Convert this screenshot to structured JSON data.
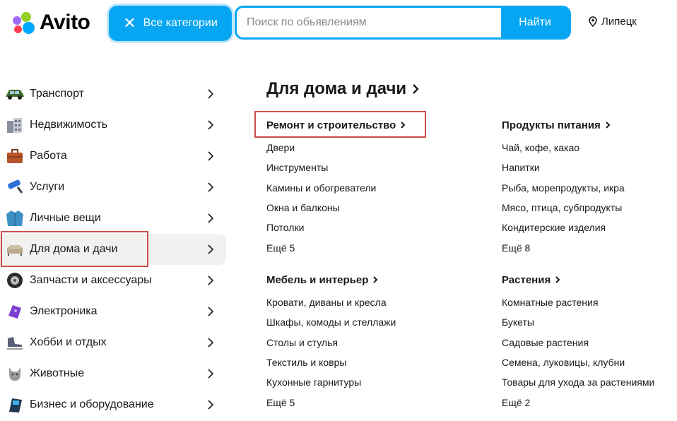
{
  "header": {
    "logo_text": "Avito",
    "logo_colors": [
      "#00aaff",
      "#ff4053",
      "#97cf26",
      "#a169f7"
    ],
    "categories_button": "Все категории",
    "search_placeholder": "Поиск по обьявлениям",
    "search_button": "Найти",
    "city": "Липецк",
    "accent": "#07a6f2"
  },
  "sidebar": {
    "items": [
      {
        "label": "Транспорт",
        "icon": "car-icon"
      },
      {
        "label": "Недвижимость",
        "icon": "building-icon"
      },
      {
        "label": "Работа",
        "icon": "briefcase-icon"
      },
      {
        "label": "Услуги",
        "icon": "roller-icon"
      },
      {
        "label": "Личные вещи",
        "icon": "jacket-icon"
      },
      {
        "label": "Для дома и дачи",
        "icon": "sofa-icon",
        "active": true
      },
      {
        "label": "Запчасти и аксессуары",
        "icon": "tire-icon"
      },
      {
        "label": "Электроника",
        "icon": "gamepad-icon"
      },
      {
        "label": "Хобби и отдых",
        "icon": "skates-icon"
      },
      {
        "label": "Животные",
        "icon": "cat-icon"
      },
      {
        "label": "Бизнес и оборудование",
        "icon": "terminal-icon"
      }
    ]
  },
  "main": {
    "title": "Для дома и дачи",
    "groups": [
      {
        "title": "Ремонт и строительство",
        "links": [
          "Двери",
          "Инструменты",
          "Камины и обогреватели",
          "Окна и балконы",
          "Потолки"
        ],
        "more": "Ещё 5"
      },
      {
        "title": "Продукты питания",
        "links": [
          "Чай, кофе, какао",
          "Напитки",
          "Рыба, морепродукты, икра",
          "Мясо, птица, субпродукты",
          "Кондитерские изделия"
        ],
        "more": "Ещё 8"
      },
      {
        "title": "Мебель и интерьер",
        "links": [
          "Кровати, диваны и кресла",
          "Шкафы, комоды и стеллажи",
          "Столы и стулья",
          "Текстиль и ковры",
          "Кухонные гарнитуры"
        ],
        "more": "Ещё 5"
      },
      {
        "title": "Растения",
        "links": [
          "Комнатные растения",
          "Букеты",
          "Садовые растения",
          "Семена, луковицы, клубни",
          "Товары для ухода за растениями"
        ],
        "more": "Ещё 2"
      }
    ]
  }
}
